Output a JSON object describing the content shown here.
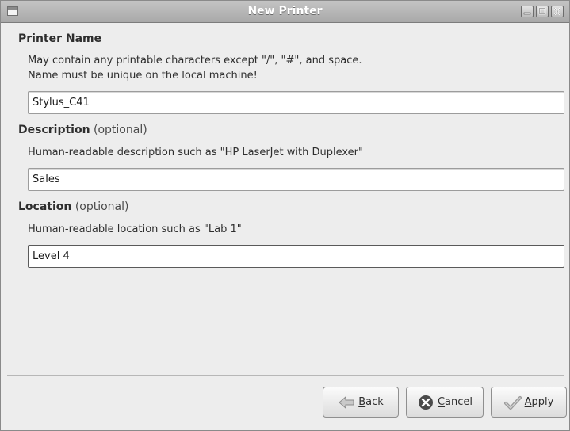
{
  "window": {
    "title": "New Printer"
  },
  "printer_name": {
    "heading": "Printer Name",
    "hint_line1": "May contain any printable characters except \"/\", \"#\", and space.",
    "hint_line2": "Name must be unique on the local machine!",
    "value": "Stylus_C41"
  },
  "description": {
    "heading": "Description",
    "optional": "(optional)",
    "hint": "Human-readable description such as \"HP LaserJet with Duplexer\"",
    "value": "Sales"
  },
  "location": {
    "heading": "Location",
    "optional": "(optional)",
    "hint": "Human-readable location such as \"Lab 1\"",
    "value": "Level 4"
  },
  "buttons": {
    "back_mnemonic": "B",
    "back_rest": "ack",
    "cancel_mnemonic": "C",
    "cancel_rest": "ancel",
    "apply_mnemonic": "A",
    "apply_rest": "pply"
  },
  "icons": {
    "window_menu": "window-menu-icon",
    "minimize": "minimize-icon",
    "maximize": "maximize-icon",
    "close": "close-icon",
    "back": "arrow-left-icon",
    "cancel": "cancel-x-icon",
    "apply": "checkmark-icon"
  }
}
